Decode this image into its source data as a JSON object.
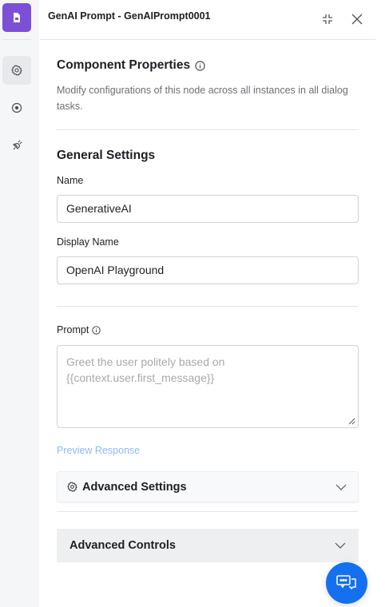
{
  "header": {
    "title": "GenAI Prompt - GenAIPrompt0001"
  },
  "component": {
    "title": "Component Properties",
    "description": "Modify configurations of this node across all instances in all dialog tasks."
  },
  "general": {
    "title": "General Settings",
    "name_label": "Name",
    "name_value": "GenerativeAI",
    "display_name_label": "Display Name",
    "display_name_value": "OpenAI Playground"
  },
  "prompt": {
    "label": "Prompt",
    "placeholder": "Greet the user politely based on {{context.user.first_message}}",
    "preview_link": "Preview Response"
  },
  "advanced_settings": {
    "label": "Advanced Settings"
  },
  "advanced_controls": {
    "label": "Advanced Controls"
  },
  "colors": {
    "brand": "#7c4fd6",
    "fab": "#1570ef",
    "link": "#8db8f7"
  }
}
